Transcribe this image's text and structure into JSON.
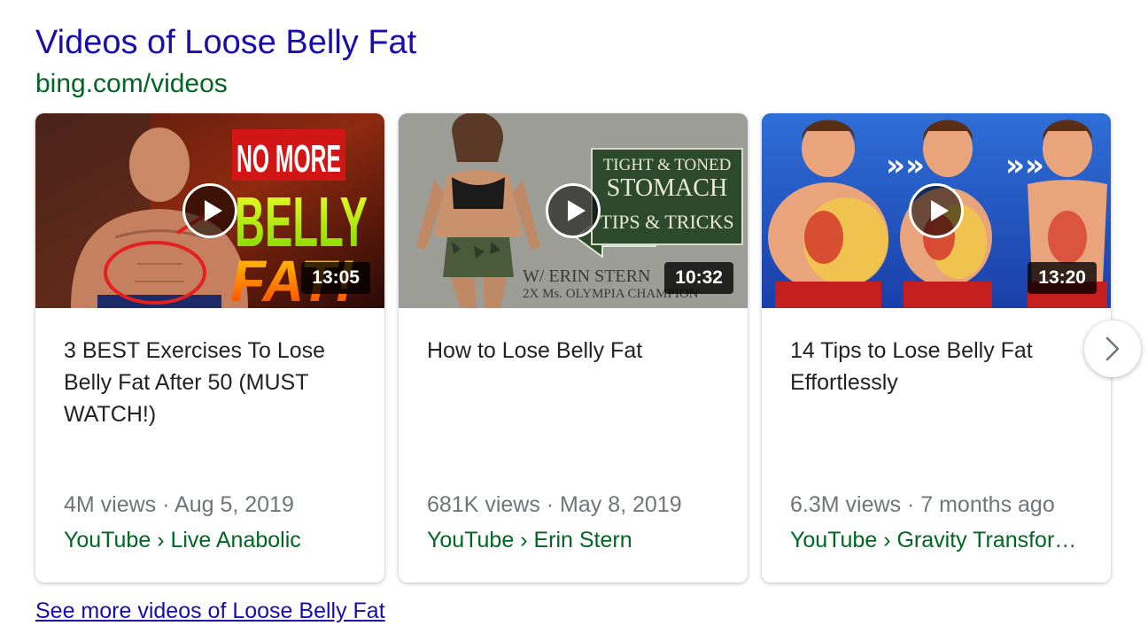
{
  "header": {
    "title": "Videos of Loose Belly Fat",
    "source": "bing.com/videos"
  },
  "videos": [
    {
      "title": "3 BEST Exercises To Lose Belly Fat After 50 (MUST WATCH!)",
      "duration": "13:05",
      "meta": "4M views · Aug 5, 2019",
      "channel": "YouTube › Live Anabolic",
      "thumb_text": [
        "NO MORE",
        "BELLY",
        "FAT!"
      ]
    },
    {
      "title": "How to Lose Belly Fat",
      "duration": "10:32",
      "meta": "681K views · May 8, 2019",
      "channel": "YouTube › Erin Stern",
      "thumb_text": [
        "TIGHT & TONED",
        "STOMACH",
        "TIPS & TRICKS",
        "W/ ERIN STERN",
        "2X Ms. OLYMPIA CHAMPION"
      ]
    },
    {
      "title": "14 Tips to Lose Belly Fat Effortlessly",
      "duration": "13:20",
      "meta": "6.3M views · 7 months ago",
      "channel": "YouTube › Gravity Transfor…",
      "thumb_text": []
    }
  ],
  "see_more": "See more videos of Loose Belly Fat",
  "icons": {
    "play": "play-icon",
    "next": "chevron-right-icon"
  },
  "colors": {
    "link": "#1a0dab",
    "url_green": "#006621",
    "meta_gray": "#70757a"
  }
}
